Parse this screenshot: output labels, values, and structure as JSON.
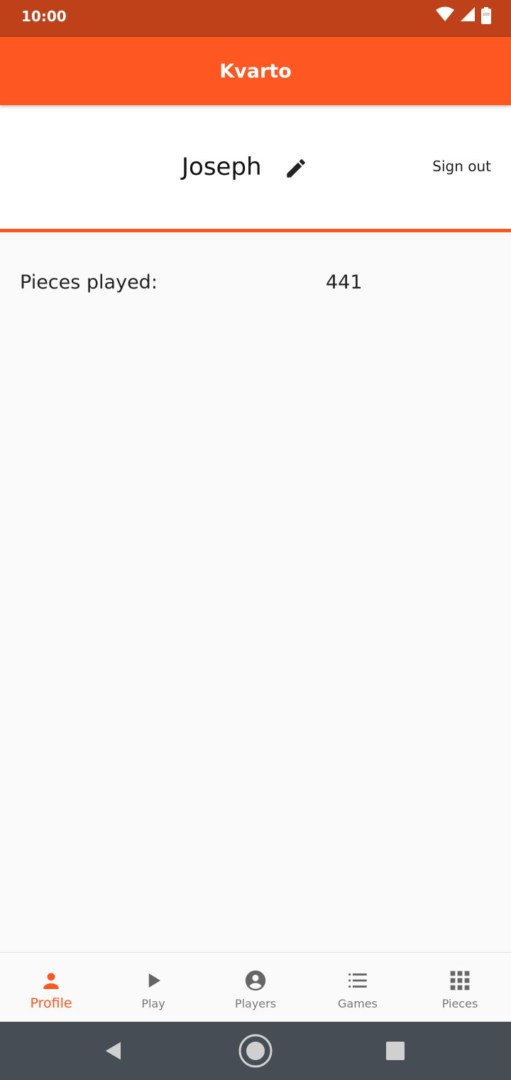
{
  "status_bar": {
    "time": "10:00",
    "icons": [
      "wifi-icon",
      "cell-signal-icon",
      "battery-icon"
    ],
    "battery_text": "100"
  },
  "app_bar": {
    "title": "Kvarto"
  },
  "profile": {
    "player_name": "Joseph",
    "sign_out_label": "Sign out"
  },
  "stats": {
    "pieces_played_label": "Pieces played:",
    "pieces_played_value": "441"
  },
  "bottom_nav": {
    "items": [
      {
        "label": "Profile",
        "icon": "person-icon",
        "active": true
      },
      {
        "label": "Play",
        "icon": "play-icon",
        "active": false
      },
      {
        "label": "Players",
        "icon": "account-circle-icon",
        "active": false
      },
      {
        "label": "Games",
        "icon": "list-icon",
        "active": false
      },
      {
        "label": "Pieces",
        "icon": "grid-icon",
        "active": false
      }
    ]
  },
  "colors": {
    "primary": "#ff5722",
    "status_bar": "#bf4119",
    "system_nav": "#474d54",
    "inactive_nav": "#777777"
  }
}
